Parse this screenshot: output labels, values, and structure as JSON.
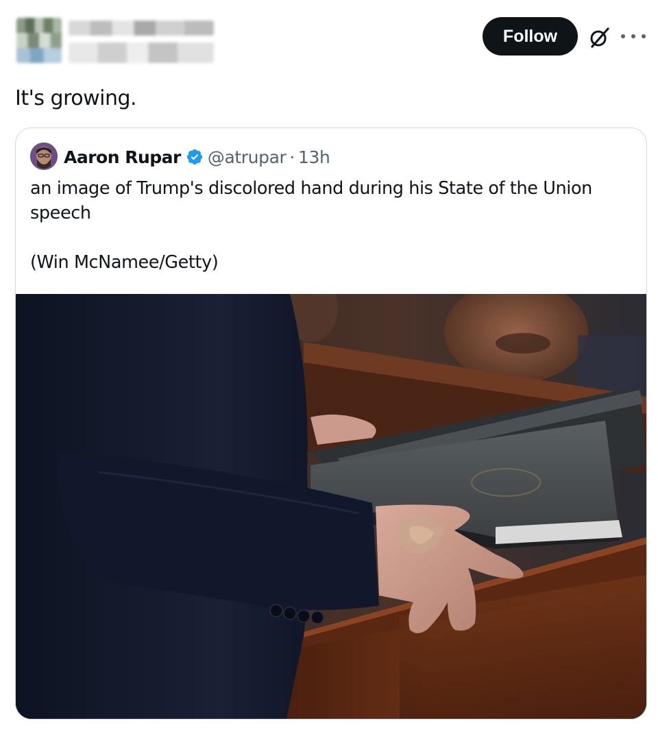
{
  "post": {
    "text": "It's growing.",
    "follow_label": "Follow",
    "icons": {
      "grok": "grok-icon",
      "more": "more-options-icon"
    }
  },
  "quoted": {
    "name": "Aaron Rupar",
    "handle": "@atrupar",
    "separator": "·",
    "time": "13h",
    "body_line1": "an image of Trump's discolored hand during his State of the Union speech",
    "body_line2": "(Win McNamee/Getty)",
    "icons": {
      "verified": "verified-badge-icon"
    }
  },
  "colors": {
    "follow_bg": "#0f1419",
    "verified": "#1d9bf0",
    "secondary_text": "#536471",
    "border": "#cfd9de"
  }
}
